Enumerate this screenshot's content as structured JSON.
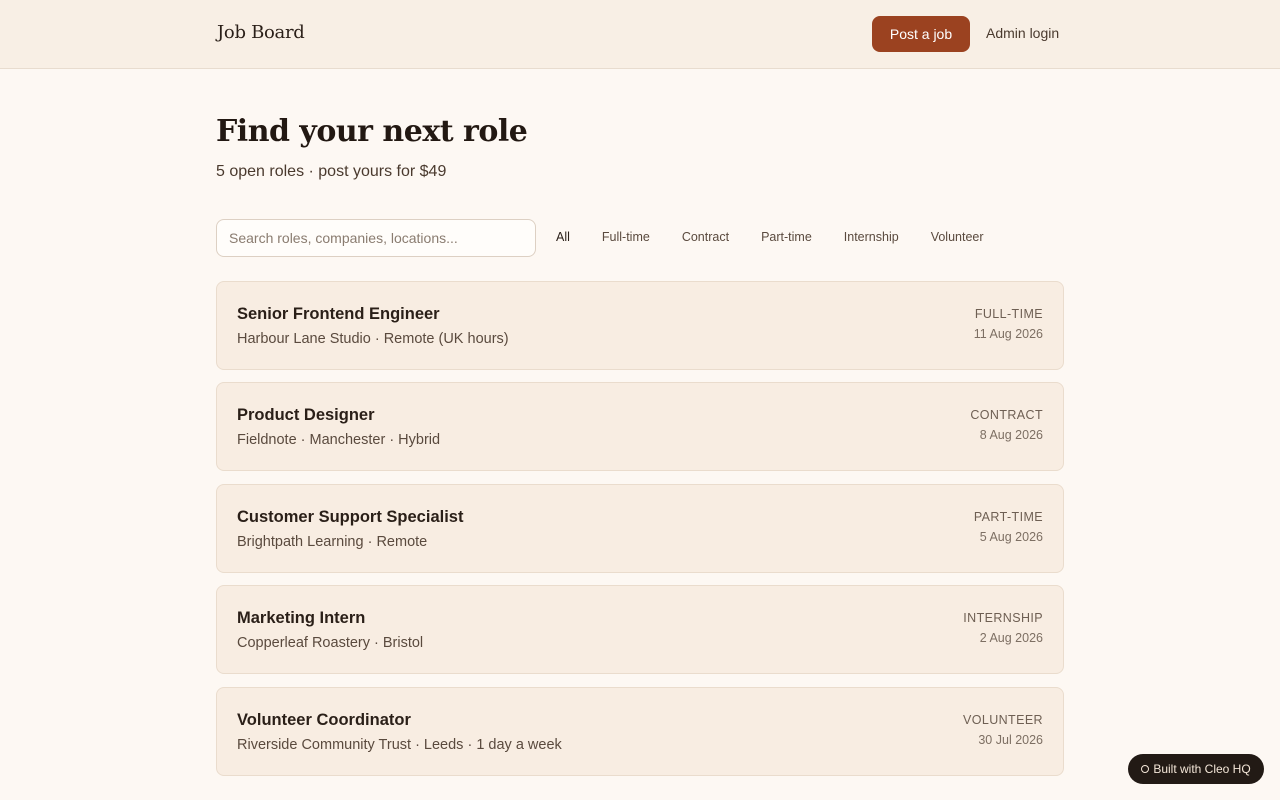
{
  "header": {
    "brand": "Job Board",
    "post_job_label": "Post a job",
    "admin_login_label": "Admin login"
  },
  "hero": {
    "title": "Find your next role",
    "subtitle": "5 open roles · post yours for $49"
  },
  "search": {
    "placeholder": "Search roles, companies, locations...",
    "value": ""
  },
  "filters": {
    "selected": "All",
    "items": [
      "All",
      "Full-time",
      "Contract",
      "Part-time",
      "Internship",
      "Volunteer"
    ]
  },
  "jobs": [
    {
      "title": "Senior Frontend Engineer",
      "meta": "Harbour Lane Studio · Remote (UK hours)",
      "type": "FULL-TIME",
      "date": "11 Aug 2026"
    },
    {
      "title": "Product Designer",
      "meta": "Fieldnote · Manchester · Hybrid",
      "type": "CONTRACT",
      "date": "8 Aug 2026"
    },
    {
      "title": "Customer Support Specialist",
      "meta": "Brightpath Learning · Remote",
      "type": "PART-TIME",
      "date": "5 Aug 2026"
    },
    {
      "title": "Marketing Intern",
      "meta": "Copperleaf Roastery · Bristol",
      "type": "INTERNSHIP",
      "date": "2 Aug 2026"
    },
    {
      "title": "Volunteer Coordinator",
      "meta": "Riverside Community Trust · Leeds · 1 day a week",
      "type": "VOLUNTEER",
      "date": "30 Jul 2026"
    }
  ],
  "badge": {
    "label": "Built with Cleo HQ"
  },
  "colors": {
    "accent": "#9b4220",
    "background": "#fdf8f3",
    "card": "#f8ede2",
    "header": "#f8efe5"
  }
}
